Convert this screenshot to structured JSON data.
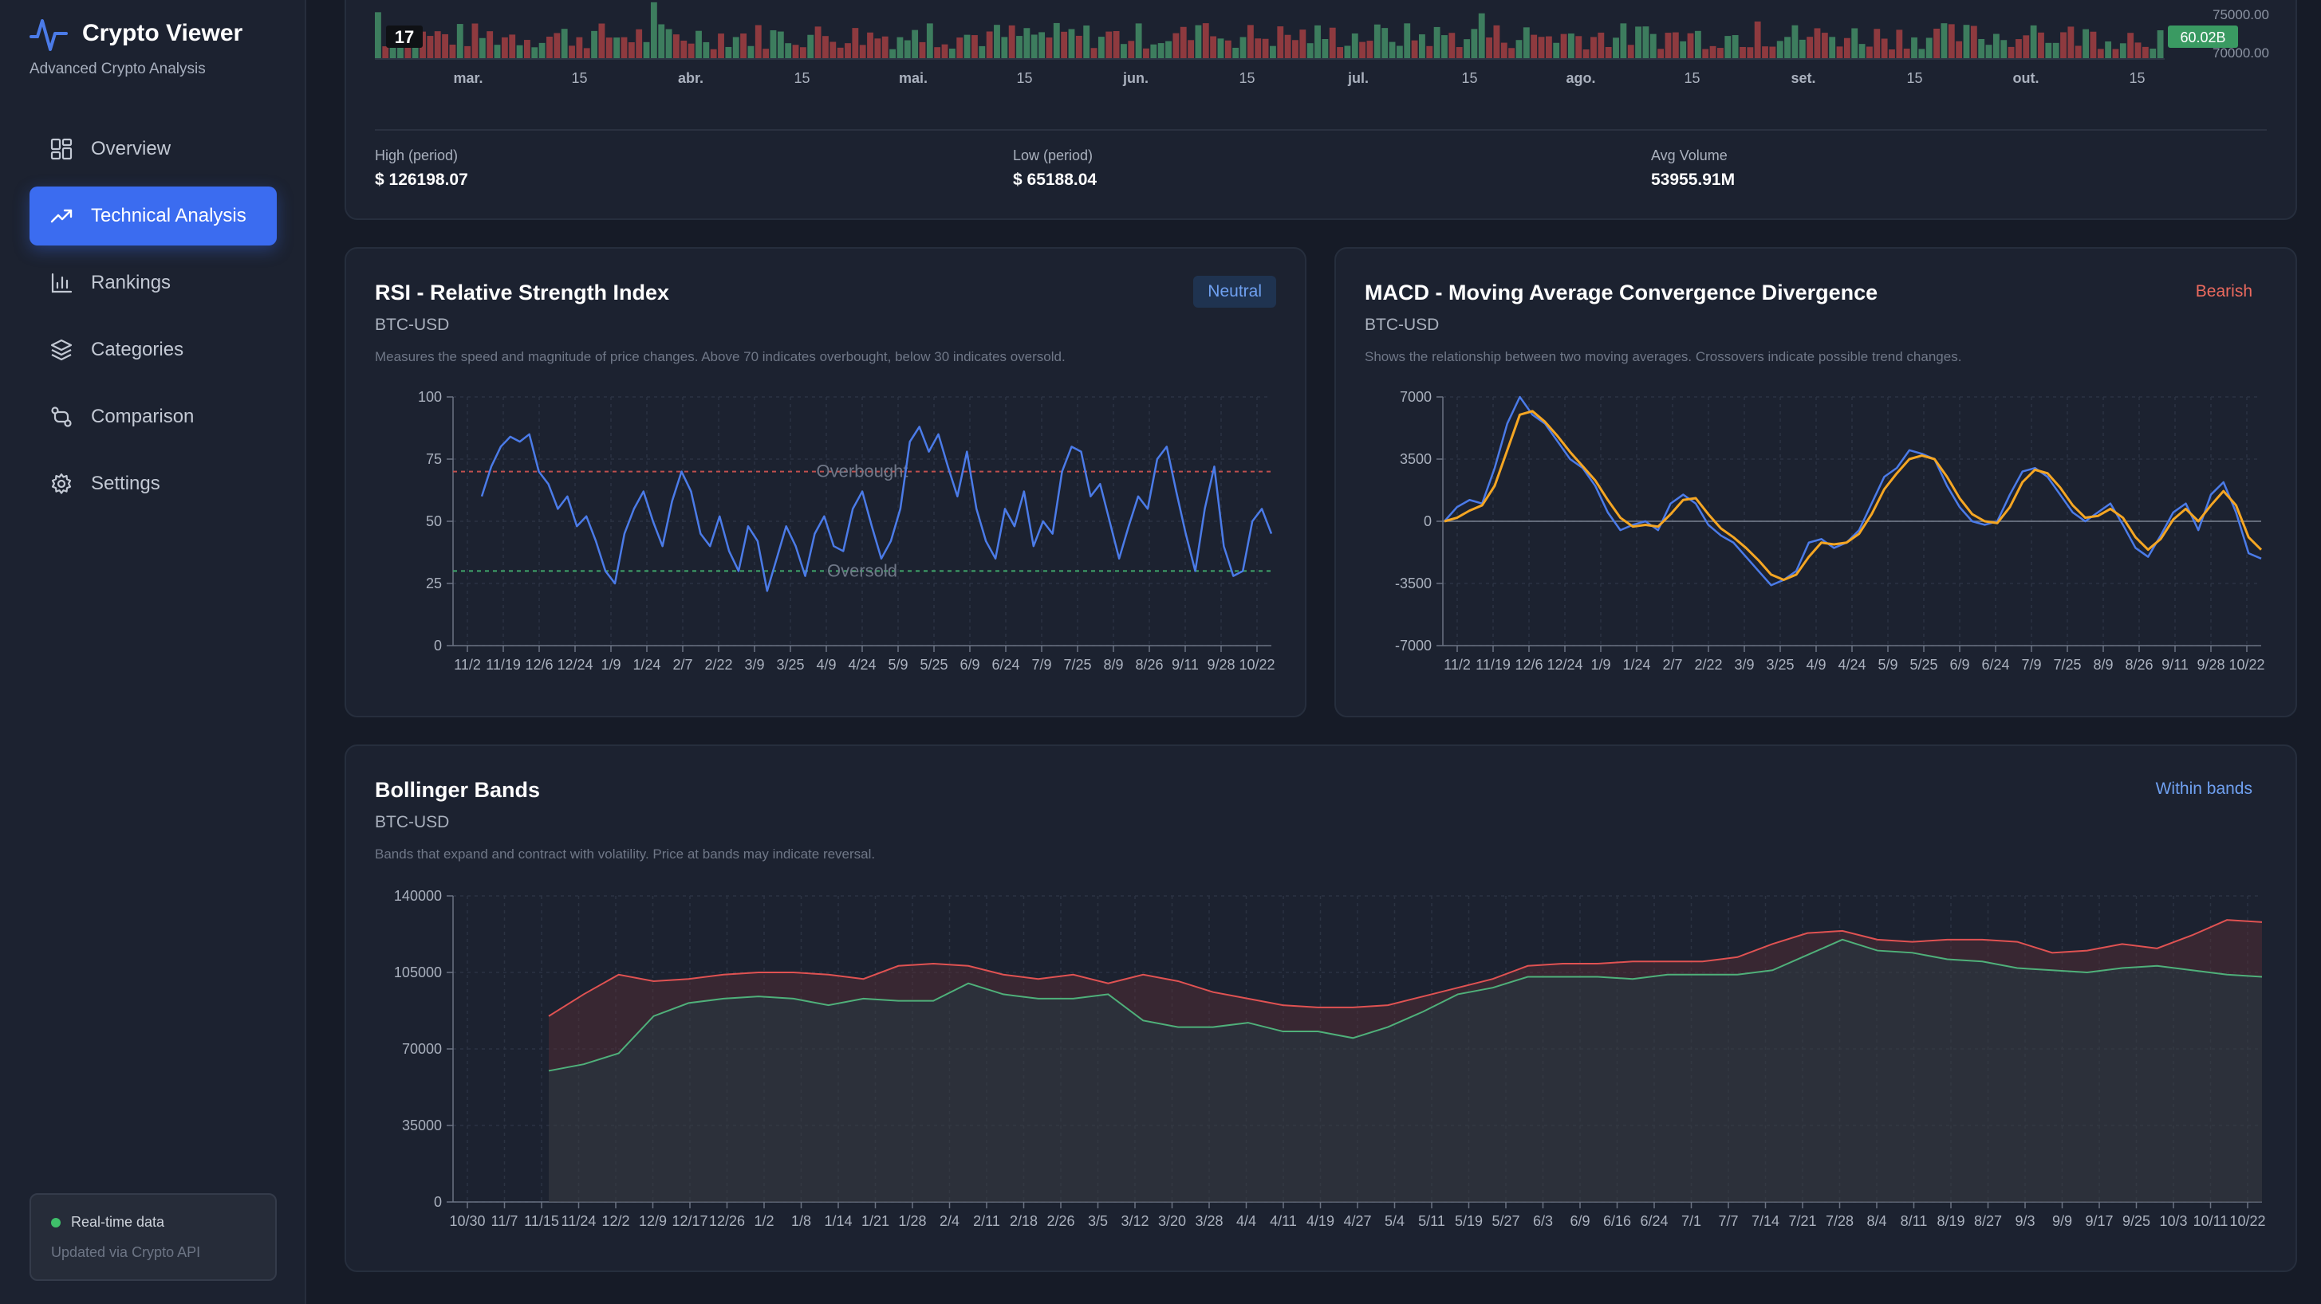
{
  "app": {
    "title": "Crypto Viewer",
    "subtitle": "Advanced Crypto Analysis"
  },
  "sidebar": {
    "items": [
      {
        "label": "Overview",
        "icon": "grid-icon",
        "active": false
      },
      {
        "label": "Technical Analysis",
        "icon": "trending-up-icon",
        "active": true
      },
      {
        "label": "Rankings",
        "icon": "bar-chart-icon",
        "active": false
      },
      {
        "label": "Categories",
        "icon": "layers-icon",
        "active": false
      },
      {
        "label": "Comparison",
        "icon": "compare-icon",
        "active": false
      },
      {
        "label": "Settings",
        "icon": "gear-icon",
        "active": false
      }
    ],
    "status": {
      "label": "Real-time data",
      "sub": "Updated via Crypto API"
    }
  },
  "price_panel": {
    "months": [
      "mar.",
      "15",
      "abr.",
      "15",
      "mai.",
      "15",
      "jun.",
      "15",
      "jul.",
      "15",
      "ago.",
      "15",
      "set.",
      "15",
      "out.",
      "15"
    ],
    "price_ticks": [
      "75000.00",
      "70000.00"
    ],
    "volume_tag": "60.02B",
    "logo": "17",
    "stats": [
      {
        "label": "High (period)",
        "value": "$ 126198.07"
      },
      {
        "label": "Low (period)",
        "value": "$ 65188.04"
      },
      {
        "label": "Avg Volume",
        "value": "53955.91M"
      }
    ]
  },
  "rsi": {
    "title": "RSI - Relative Strength Index",
    "symbol": "BTC-USD",
    "description": "Measures the speed and magnitude of price changes. Above 70 indicates overbought, below 30 indicates oversold.",
    "badge": "Neutral",
    "overbought_label": "Overbought",
    "oversold_label": "Oversold",
    "chart_data": {
      "type": "line",
      "ylim": [
        0,
        100
      ],
      "y_ticks": [
        "100",
        "75",
        "50",
        "25",
        "0"
      ],
      "x_ticks": [
        "11/2",
        "11/19",
        "12/6",
        "12/24",
        "1/9",
        "1/24",
        "2/7",
        "2/22",
        "3/9",
        "3/25",
        "4/9",
        "4/24",
        "5/9",
        "5/25",
        "6/9",
        "6/24",
        "7/9",
        "7/25",
        "8/9",
        "8/26",
        "9/11",
        "9/28",
        "10/22"
      ],
      "overbought": 70,
      "oversold": 30,
      "series": [
        {
          "values": [
            60,
            72,
            80,
            84,
            82,
            85,
            70,
            65,
            55,
            60,
            48,
            52,
            42,
            30,
            25,
            45,
            55,
            62,
            50,
            40,
            58,
            70,
            62,
            45,
            40,
            52,
            38,
            30,
            48,
            42,
            22,
            35,
            48,
            40,
            28,
            45,
            52,
            40,
            38,
            55,
            62,
            48,
            35,
            42,
            55,
            82,
            88,
            78,
            85,
            72,
            60,
            78,
            55,
            42,
            35,
            55,
            48,
            62,
            40,
            50,
            45,
            70,
            80,
            78,
            60,
            65,
            50,
            35,
            48,
            60,
            55,
            75,
            80,
            62,
            45,
            30,
            55,
            72,
            40,
            28,
            30,
            50,
            55,
            45
          ]
        }
      ],
      "color": "#4b7be8"
    }
  },
  "macd": {
    "title": "MACD - Moving Average Convergence Divergence",
    "symbol": "BTC-USD",
    "description": "Shows the relationship between two moving averages. Crossovers indicate possible trend changes.",
    "badge": "Bearish",
    "chart_data": {
      "type": "line",
      "ylim": [
        -7000,
        7000
      ],
      "y_ticks": [
        "7000",
        "3500",
        "0",
        "-3500",
        "-7000"
      ],
      "x_ticks": [
        "11/2",
        "11/19",
        "12/6",
        "12/24",
        "1/9",
        "1/24",
        "2/7",
        "2/22",
        "3/9",
        "3/25",
        "4/9",
        "4/24",
        "5/9",
        "5/25",
        "6/9",
        "6/24",
        "7/9",
        "7/25",
        "8/9",
        "8/26",
        "9/11",
        "9/28",
        "10/22"
      ],
      "series": [
        {
          "values": [
            0,
            800,
            1200,
            1000,
            3000,
            5500,
            7000,
            6000,
            5500,
            4500,
            3500,
            3000,
            2000,
            500,
            -500,
            -200,
            0,
            -500,
            1000,
            1500,
            1000,
            -200,
            -800,
            -1200,
            -2000,
            -2800,
            -3600,
            -3300,
            -2800,
            -1200,
            -1000,
            -1500,
            -1200,
            -500,
            1000,
            2500,
            3000,
            4000,
            3800,
            3500,
            2000,
            800,
            0,
            -200,
            0,
            1500,
            2800,
            3000,
            2500,
            1500,
            500,
            0,
            500,
            1000,
            -200,
            -1500,
            -2000,
            -800,
            500,
            1000,
            -500,
            1500,
            2200,
            500,
            -1800,
            -2100
          ],
          "color": "#4b7be8"
        },
        {
          "values": [
            0,
            200,
            600,
            900,
            2000,
            4000,
            6000,
            6200,
            5600,
            4800,
            3900,
            3100,
            2300,
            1200,
            200,
            -300,
            -200,
            -300,
            400,
            1200,
            1300,
            400,
            -400,
            -900,
            -1500,
            -2200,
            -3000,
            -3300,
            -3000,
            -2000,
            -1200,
            -1300,
            -1200,
            -700,
            400,
            1800,
            2700,
            3500,
            3700,
            3500,
            2500,
            1300,
            400,
            0,
            -100,
            800,
            2200,
            2900,
            2700,
            1900,
            900,
            200,
            300,
            700,
            200,
            -900,
            -1600,
            -1000,
            100,
            700,
            0,
            900,
            1700,
            900,
            -900,
            -1600
          ],
          "color": "#f5a623"
        }
      ]
    }
  },
  "bollinger": {
    "title": "Bollinger Bands",
    "symbol": "BTC-USD",
    "description": "Bands that expand and contract with volatility. Price at bands may indicate reversal.",
    "badge": "Within bands",
    "chart_data": {
      "type": "area",
      "ylim": [
        0,
        140000
      ],
      "y_ticks": [
        "140000",
        "105000",
        "70000",
        "35000",
        "0"
      ],
      "x_ticks": [
        "10/30",
        "11/7",
        "11/15",
        "11/24",
        "12/2",
        "12/9",
        "12/17",
        "12/26",
        "1/2",
        "1/8",
        "1/14",
        "1/21",
        "1/28",
        "2/4",
        "2/11",
        "2/18",
        "2/26",
        "3/5",
        "3/12",
        "3/20",
        "3/28",
        "4/4",
        "4/11",
        "4/19",
        "4/27",
        "5/4",
        "5/11",
        "5/19",
        "5/27",
        "6/3",
        "6/9",
        "6/16",
        "6/24",
        "7/1",
        "7/7",
        "7/14",
        "7/21",
        "7/28",
        "8/4",
        "8/11",
        "8/19",
        "8/27",
        "9/3",
        "9/9",
        "9/17",
        "9/25",
        "10/3",
        "10/11",
        "10/22"
      ],
      "series": [
        {
          "name": "upper",
          "values": [
            85000,
            95000,
            104000,
            101000,
            102000,
            104000,
            105000,
            105000,
            104000,
            102000,
            108000,
            109000,
            108000,
            104000,
            102000,
            104000,
            100000,
            104000,
            101000,
            96000,
            93000,
            90000,
            89000,
            89000,
            90000,
            94000,
            98000,
            102000,
            108000,
            109000,
            109000,
            110000,
            110000,
            110000,
            112000,
            118000,
            123000,
            124000,
            120000,
            119000,
            120000,
            120000,
            119000,
            114000,
            115000,
            118000,
            116000,
            122000,
            129000,
            128000
          ],
          "color": "#e05252"
        },
        {
          "name": "lower",
          "values": [
            60000,
            63000,
            68000,
            85000,
            91000,
            93000,
            94000,
            93000,
            90000,
            93000,
            92000,
            92000,
            100000,
            95000,
            93000,
            93000,
            95000,
            83000,
            80000,
            80000,
            82000,
            78000,
            78000,
            75000,
            80000,
            87000,
            95000,
            98000,
            103000,
            103000,
            103000,
            102000,
            104000,
            104000,
            104000,
            106000,
            113000,
            120000,
            115000,
            114000,
            111000,
            110000,
            107000,
            106000,
            105000,
            107000,
            108000,
            106000,
            104000,
            103000
          ],
          "color": "#4fb07a"
        }
      ]
    }
  }
}
